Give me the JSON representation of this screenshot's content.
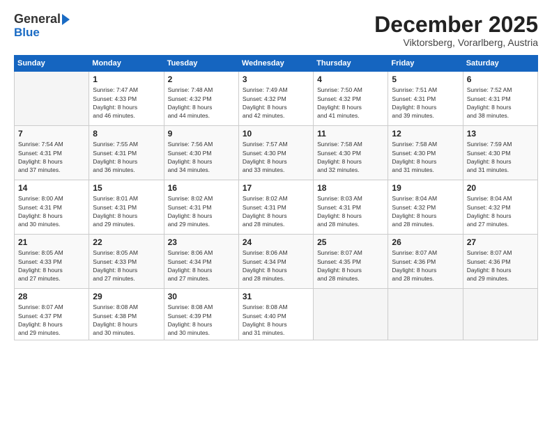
{
  "header": {
    "logo_line1": "General",
    "logo_line2": "Blue",
    "month": "December 2025",
    "location": "Viktorsberg, Vorarlberg, Austria"
  },
  "days_of_week": [
    "Sunday",
    "Monday",
    "Tuesday",
    "Wednesday",
    "Thursday",
    "Friday",
    "Saturday"
  ],
  "weeks": [
    [
      {
        "day": "",
        "info": ""
      },
      {
        "day": "1",
        "info": "Sunrise: 7:47 AM\nSunset: 4:33 PM\nDaylight: 8 hours\nand 46 minutes."
      },
      {
        "day": "2",
        "info": "Sunrise: 7:48 AM\nSunset: 4:32 PM\nDaylight: 8 hours\nand 44 minutes."
      },
      {
        "day": "3",
        "info": "Sunrise: 7:49 AM\nSunset: 4:32 PM\nDaylight: 8 hours\nand 42 minutes."
      },
      {
        "day": "4",
        "info": "Sunrise: 7:50 AM\nSunset: 4:32 PM\nDaylight: 8 hours\nand 41 minutes."
      },
      {
        "day": "5",
        "info": "Sunrise: 7:51 AM\nSunset: 4:31 PM\nDaylight: 8 hours\nand 39 minutes."
      },
      {
        "day": "6",
        "info": "Sunrise: 7:52 AM\nSunset: 4:31 PM\nDaylight: 8 hours\nand 38 minutes."
      }
    ],
    [
      {
        "day": "7",
        "info": "Sunrise: 7:54 AM\nSunset: 4:31 PM\nDaylight: 8 hours\nand 37 minutes."
      },
      {
        "day": "8",
        "info": "Sunrise: 7:55 AM\nSunset: 4:31 PM\nDaylight: 8 hours\nand 36 minutes."
      },
      {
        "day": "9",
        "info": "Sunrise: 7:56 AM\nSunset: 4:30 PM\nDaylight: 8 hours\nand 34 minutes."
      },
      {
        "day": "10",
        "info": "Sunrise: 7:57 AM\nSunset: 4:30 PM\nDaylight: 8 hours\nand 33 minutes."
      },
      {
        "day": "11",
        "info": "Sunrise: 7:58 AM\nSunset: 4:30 PM\nDaylight: 8 hours\nand 32 minutes."
      },
      {
        "day": "12",
        "info": "Sunrise: 7:58 AM\nSunset: 4:30 PM\nDaylight: 8 hours\nand 31 minutes."
      },
      {
        "day": "13",
        "info": "Sunrise: 7:59 AM\nSunset: 4:30 PM\nDaylight: 8 hours\nand 31 minutes."
      }
    ],
    [
      {
        "day": "14",
        "info": "Sunrise: 8:00 AM\nSunset: 4:31 PM\nDaylight: 8 hours\nand 30 minutes."
      },
      {
        "day": "15",
        "info": "Sunrise: 8:01 AM\nSunset: 4:31 PM\nDaylight: 8 hours\nand 29 minutes."
      },
      {
        "day": "16",
        "info": "Sunrise: 8:02 AM\nSunset: 4:31 PM\nDaylight: 8 hours\nand 29 minutes."
      },
      {
        "day": "17",
        "info": "Sunrise: 8:02 AM\nSunset: 4:31 PM\nDaylight: 8 hours\nand 28 minutes."
      },
      {
        "day": "18",
        "info": "Sunrise: 8:03 AM\nSunset: 4:31 PM\nDaylight: 8 hours\nand 28 minutes."
      },
      {
        "day": "19",
        "info": "Sunrise: 8:04 AM\nSunset: 4:32 PM\nDaylight: 8 hours\nand 28 minutes."
      },
      {
        "day": "20",
        "info": "Sunrise: 8:04 AM\nSunset: 4:32 PM\nDaylight: 8 hours\nand 27 minutes."
      }
    ],
    [
      {
        "day": "21",
        "info": "Sunrise: 8:05 AM\nSunset: 4:33 PM\nDaylight: 8 hours\nand 27 minutes."
      },
      {
        "day": "22",
        "info": "Sunrise: 8:05 AM\nSunset: 4:33 PM\nDaylight: 8 hours\nand 27 minutes."
      },
      {
        "day": "23",
        "info": "Sunrise: 8:06 AM\nSunset: 4:34 PM\nDaylight: 8 hours\nand 27 minutes."
      },
      {
        "day": "24",
        "info": "Sunrise: 8:06 AM\nSunset: 4:34 PM\nDaylight: 8 hours\nand 28 minutes."
      },
      {
        "day": "25",
        "info": "Sunrise: 8:07 AM\nSunset: 4:35 PM\nDaylight: 8 hours\nand 28 minutes."
      },
      {
        "day": "26",
        "info": "Sunrise: 8:07 AM\nSunset: 4:36 PM\nDaylight: 8 hours\nand 28 minutes."
      },
      {
        "day": "27",
        "info": "Sunrise: 8:07 AM\nSunset: 4:36 PM\nDaylight: 8 hours\nand 29 minutes."
      }
    ],
    [
      {
        "day": "28",
        "info": "Sunrise: 8:07 AM\nSunset: 4:37 PM\nDaylight: 8 hours\nand 29 minutes."
      },
      {
        "day": "29",
        "info": "Sunrise: 8:08 AM\nSunset: 4:38 PM\nDaylight: 8 hours\nand 30 minutes."
      },
      {
        "day": "30",
        "info": "Sunrise: 8:08 AM\nSunset: 4:39 PM\nDaylight: 8 hours\nand 30 minutes."
      },
      {
        "day": "31",
        "info": "Sunrise: 8:08 AM\nSunset: 4:40 PM\nDaylight: 8 hours\nand 31 minutes."
      },
      {
        "day": "",
        "info": ""
      },
      {
        "day": "",
        "info": ""
      },
      {
        "day": "",
        "info": ""
      }
    ]
  ]
}
